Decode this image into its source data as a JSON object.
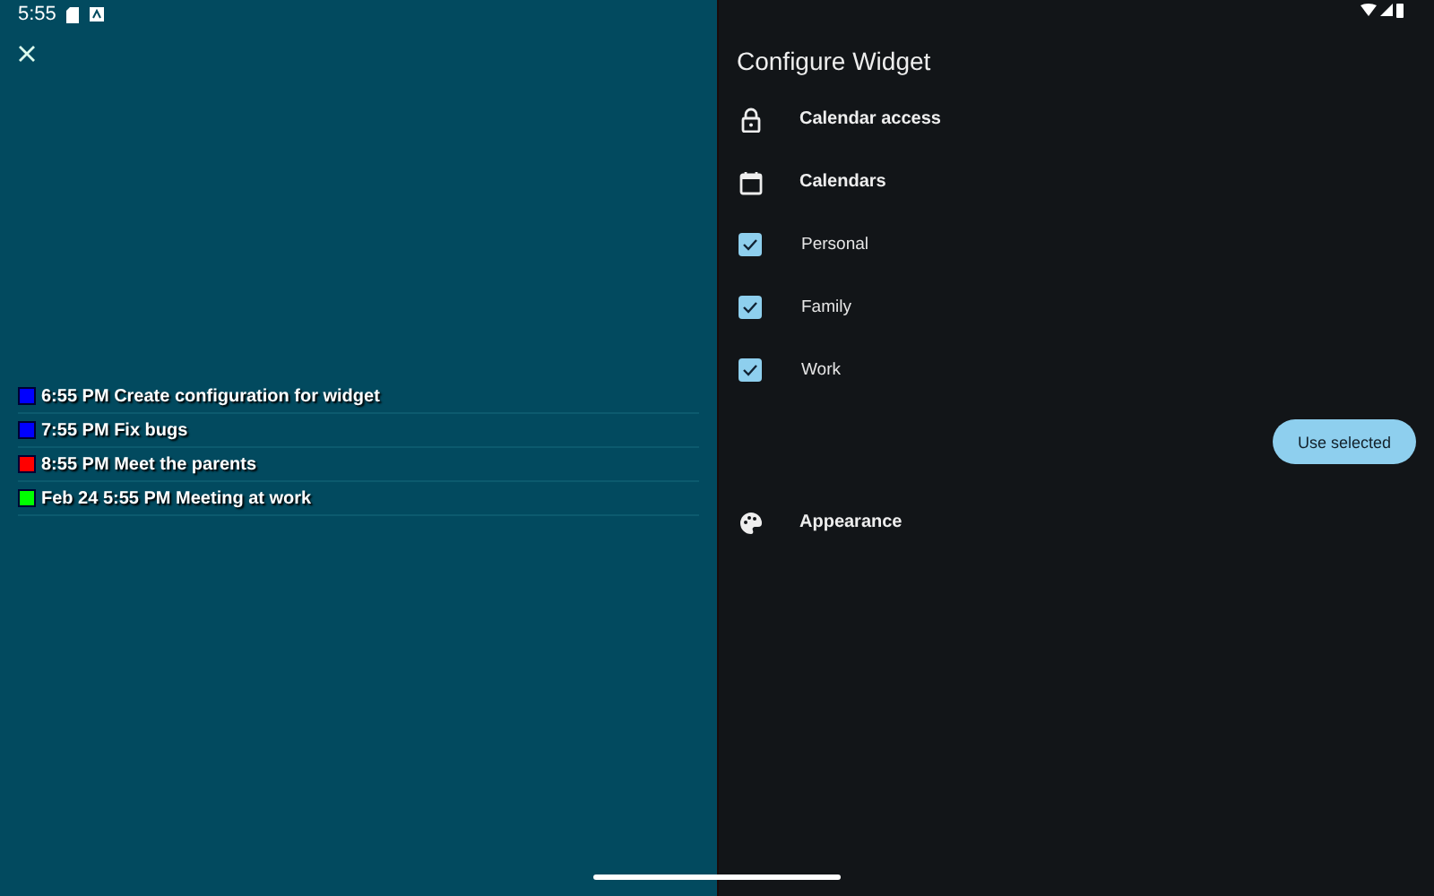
{
  "status_bar": {
    "time": "5:55"
  },
  "widget_preview": {
    "events": [
      {
        "text": "6:55 PM Create configuration for widget",
        "color": "#0000ff"
      },
      {
        "text": "7:55 PM Fix bugs",
        "color": "#0000ff"
      },
      {
        "text": "8:55 PM Meet the parents",
        "color": "#ff0000"
      },
      {
        "text": "Feb 24 5:55 PM Meeting at work",
        "color": "#00ff00"
      }
    ]
  },
  "config": {
    "title": "Configure Widget",
    "calendar_access": {
      "label": "Calendar access"
    },
    "calendars": {
      "label": "Calendars",
      "items": [
        {
          "name": "Personal",
          "checked": true
        },
        {
          "name": "Family",
          "checked": true
        },
        {
          "name": "Work",
          "checked": true
        }
      ],
      "button": "Use selected"
    },
    "appearance": {
      "label": "Appearance"
    }
  }
}
